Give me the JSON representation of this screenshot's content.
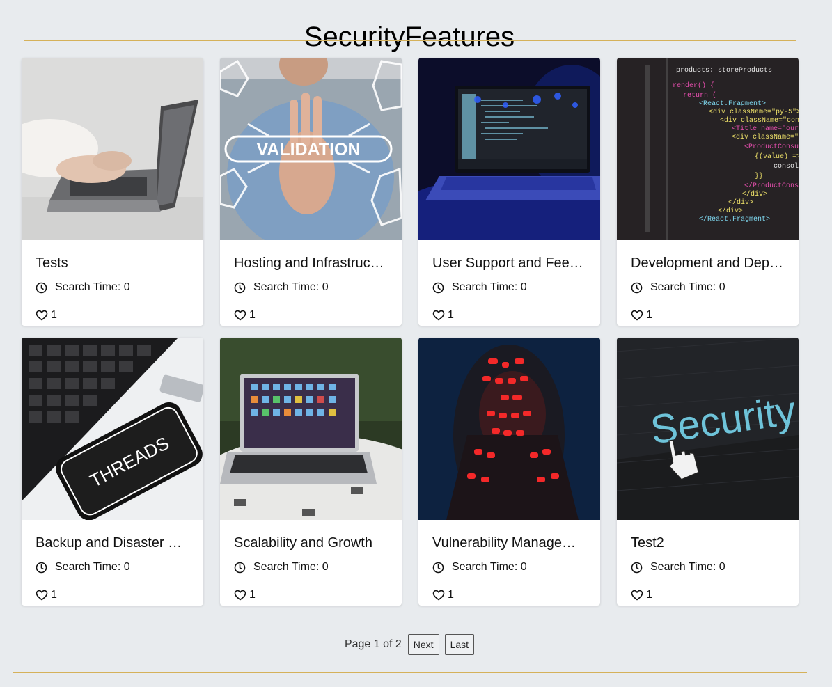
{
  "header": {
    "title": "SecurityFeatures"
  },
  "cards": [
    {
      "title": "Tests",
      "meta": "Search Time: 0",
      "likes": "1",
      "image": "laptop-typing-photo"
    },
    {
      "title": "Hosting and Infrastruc…",
      "meta": "Search Time: 0",
      "likes": "1",
      "image": "validation-hand-photo",
      "image_text": "VALIDATION"
    },
    {
      "title": "User Support and Fee…",
      "meta": "Search Time: 0",
      "likes": "1",
      "image": "dark-laptop-code-photo"
    },
    {
      "title": "Development and Dep…",
      "meta": "Search Time: 0",
      "likes": "1",
      "image": "code-screen-photo"
    },
    {
      "title": "Backup and Disaster …",
      "meta": "Search Time: 0",
      "likes": "1",
      "image": "keyboard-phone-photo",
      "image_text": "THREADS"
    },
    {
      "title": "Scalability and Growth",
      "meta": "Search Time: 0",
      "likes": "1",
      "image": "macbook-table-photo"
    },
    {
      "title": "Vulnerability Manage…",
      "meta": "Search Time: 0",
      "likes": "1",
      "image": "red-projection-face-photo"
    },
    {
      "title": "Test2",
      "meta": "Search Time: 0",
      "likes": "1",
      "image": "security-cursor-photo",
      "image_text": "Security"
    }
  ],
  "icons": {
    "meta": "clock-icon",
    "likes": "heart-icon"
  },
  "pagination": {
    "status": "Page 1 of 2",
    "next_label": "Next",
    "last_label": "Last"
  },
  "colors": {
    "background": "#e8ebee",
    "rule": "#d5b15a",
    "card": "#ffffff"
  }
}
